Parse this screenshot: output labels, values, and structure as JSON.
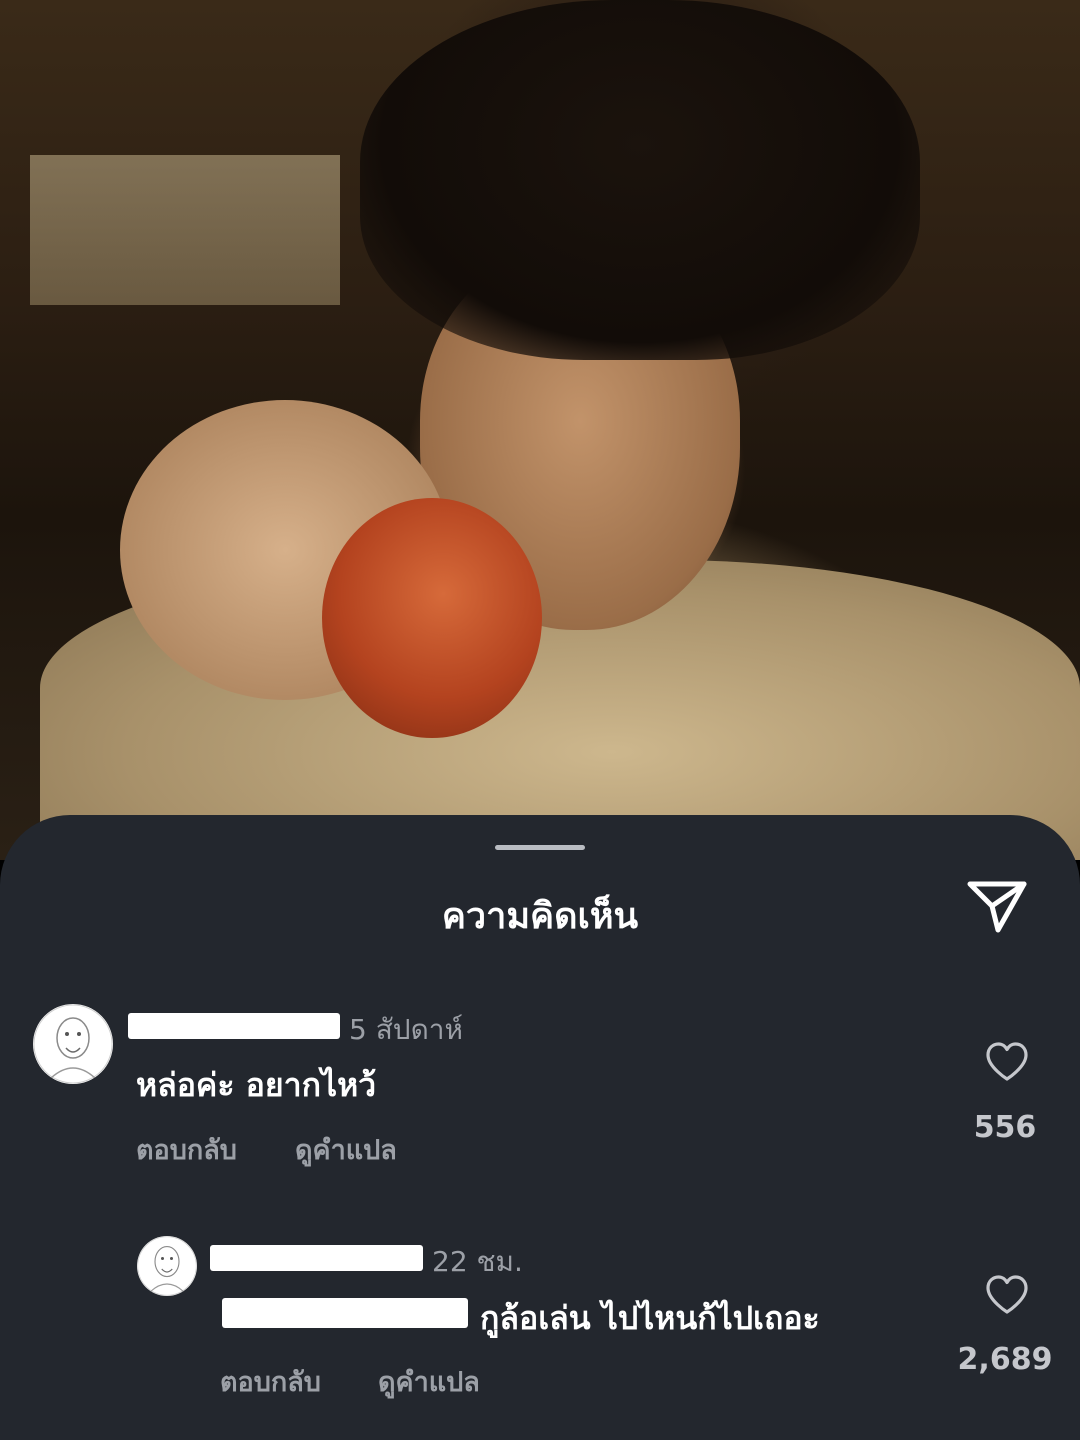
{
  "sheet": {
    "title": "ความคิดเห็น"
  },
  "comments": [
    {
      "time": "5 สัปดาห์",
      "text": "หล่อค่ะ อยากไหว้",
      "reply_label": "ตอบกลับ",
      "translate_label": "ดูคำแปล",
      "likes": "556"
    },
    {
      "time": "22 ชม.",
      "text": "กูล้อเล่น ไปไหนก้ไปเถอะ",
      "reply_label": "ตอบกลับ",
      "translate_label": "ดูคำแปล",
      "likes": "2,689"
    }
  ],
  "icons": {
    "share": "share-icon",
    "like": "heart-icon"
  },
  "colors": {
    "sheet_bg": "#23272e",
    "text_primary": "#ffffff",
    "text_secondary": "#9ca0a7"
  }
}
